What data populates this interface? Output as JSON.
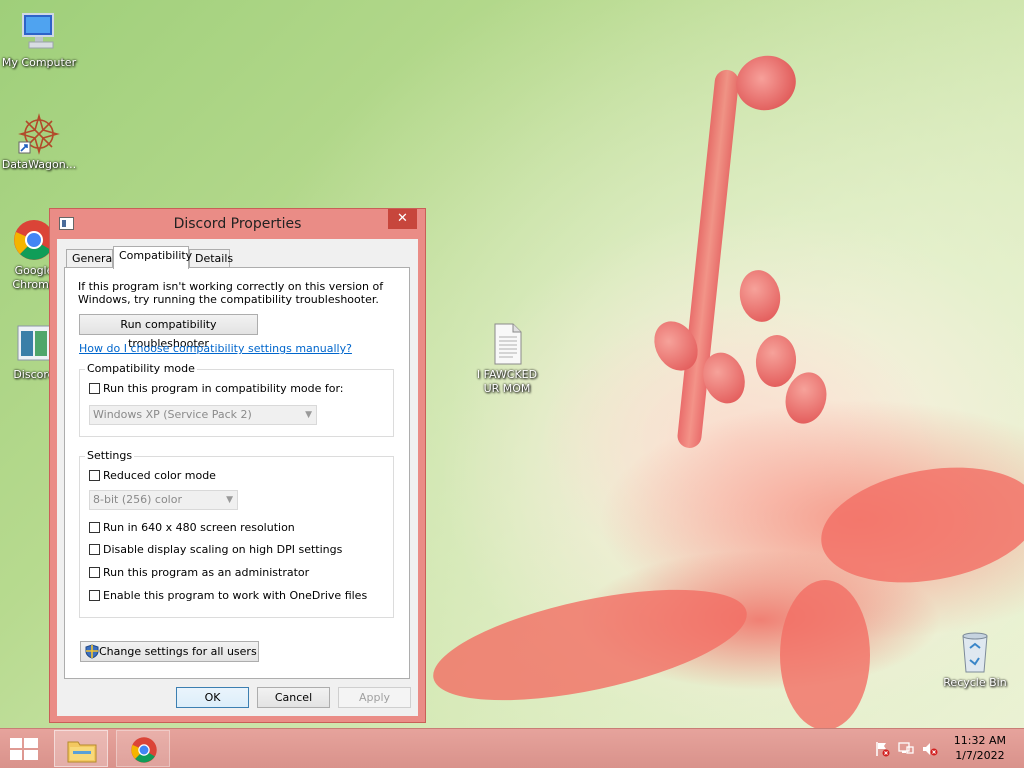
{
  "desktop": {
    "icons": [
      {
        "label": "My Computer"
      },
      {
        "label": "DataWagon..."
      },
      {
        "label": "Google Chrome"
      },
      {
        "label": "Discord"
      },
      {
        "label": "I FAWCKED UR MOM"
      },
      {
        "label": "Recycle Bin"
      }
    ]
  },
  "window": {
    "title": "Discord Properties",
    "close_glyph": "✕",
    "tabs": [
      {
        "label": "General"
      },
      {
        "label": "Compatibility",
        "active": true
      },
      {
        "label": "Details"
      }
    ],
    "intro_text": "If this program isn't working correctly on this version of Windows, try running the compatibility troubleshooter.",
    "troubleshooter_button": "Run compatibility troubleshooter",
    "help_link": "How do I choose compatibility settings manually?",
    "compat_mode": {
      "title": "Compatibility mode",
      "checkbox_label": "Run this program in compatibility mode for:",
      "checked": false,
      "os_select_value": "Windows XP (Service Pack 2)"
    },
    "settings": {
      "title": "Settings",
      "reduced_color_label": "Reduced color mode",
      "color_select_value": "8-bit (256) color",
      "options": [
        {
          "label": "Run in 640 x 480 screen resolution",
          "checked": false
        },
        {
          "label": "Disable display scaling on high DPI settings",
          "checked": false
        },
        {
          "label": "Run this program as an administrator",
          "checked": false
        },
        {
          "label": "Enable this program to work with OneDrive files",
          "checked": false
        }
      ]
    },
    "change_all_users_button": "Change settings for all users",
    "ok_button": "OK",
    "cancel_button": "Cancel",
    "apply_button": "Apply"
  },
  "taskbar": {
    "pinned": [
      {
        "name": "File Explorer"
      },
      {
        "name": "Google Chrome"
      }
    ],
    "clock_time": "11:32 AM",
    "clock_date": "1/7/2022"
  },
  "colors": {
    "window_frame": "#ea8c86",
    "taskbar": "#e6a39c",
    "close_button": "#c7463c",
    "link": "#0066cc"
  }
}
